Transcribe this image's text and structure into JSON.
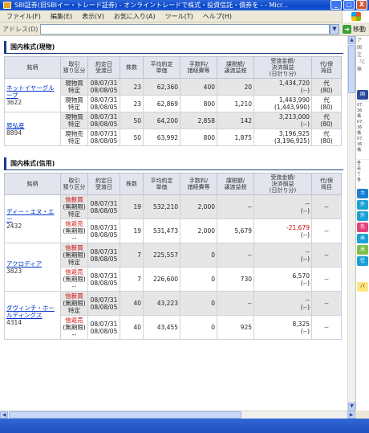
{
  "window": {
    "title": "SBI証券(旧SBIイー・トレード証券) - オンライントレードで株式・投資信託・債券を - - Micr...",
    "buttons": {
      "minimize": "_",
      "maximize": "□",
      "close": "X"
    }
  },
  "menu": [
    "ファイル(F)",
    "編集(E)",
    "表示(V)",
    "お気に入り(A)",
    "ツール(T)",
    "ヘルプ(H)"
  ],
  "address": {
    "label": "アドレス(D)",
    "value": "",
    "go_label": "移動"
  },
  "cash_section": {
    "title": "国内株式(現物)",
    "headers": {
      "name": "銘柄",
      "category": "取引\n預り区分",
      "date": "約定日\n受渡日",
      "qty": "株数",
      "price": "平均約定\n単価",
      "fee": "手数料/\n諸経費等",
      "tax": "課税額/\n譲渡益税",
      "amount": "受渡金額/\n決済損益\n(日計り分)",
      "extra": "代/保\n拇目"
    },
    "rows": [
      {
        "name": "ネットイヤーグループ",
        "code": "3622",
        "type": "現物買",
        "account": "特定",
        "trade_date": "08/07/31",
        "settle_date": "08/08/05",
        "qty": "23",
        "price": "62,360",
        "fee": "400",
        "tax": "20",
        "amount": "1,434,720",
        "pl": "(--)",
        "extra1": "代",
        "extra2": "(80)"
      },
      {
        "name": "",
        "code": "",
        "type": "現物買",
        "account": "特定",
        "trade_date": "08/07/31",
        "settle_date": "08/08/05",
        "qty": "23",
        "price": "62,869",
        "fee": "800",
        "tax": "1,210",
        "amount": "1,443,990",
        "pl": "(1,443,990)",
        "extra1": "代",
        "extra2": "(80)"
      },
      {
        "name": "原弘産",
        "code": "8894",
        "type": "現物買",
        "account": "特定",
        "trade_date": "08/07/31",
        "settle_date": "08/08/05",
        "qty": "50",
        "price": "64,200",
        "fee": "2,858",
        "tax": "142",
        "amount": "3,213,000",
        "pl": "(--)",
        "extra1": "代",
        "extra2": "(80)"
      },
      {
        "name": "",
        "code": "",
        "type": "現物売",
        "account": "特定",
        "trade_date": "08/07/31",
        "settle_date": "08/08/05",
        "qty": "50",
        "price": "63,992",
        "fee": "800",
        "tax": "1,875",
        "amount": "3,196,925",
        "pl": "(3,196,925)",
        "extra1": "代",
        "extra2": "(80)"
      }
    ]
  },
  "margin_section": {
    "title": "国内株式(信用)",
    "headers": {
      "name": "銘柄",
      "category": "取引\n預り区分",
      "date": "約定日\n受渡日",
      "qty": "株数",
      "price": "平均約定\n単価",
      "fee": "手数料/\n諸経費等",
      "tax": "課税額/\n譲渡益税",
      "amount": "受渡金額/\n決済損益\n(日計り分)",
      "extra": "代/保\n拇目"
    },
    "rows": [
      {
        "name": "ディー・エヌ・エー",
        "code": "2432",
        "type": "信新買",
        "term": "(無期限)",
        "account": "特定",
        "trade_date": "08/07/31",
        "settle_date": "08/08/05",
        "qty": "19",
        "price": "532,210",
        "fee": "2,000",
        "tax": "--",
        "amount": "--",
        "pl": "(--)",
        "extra": "--"
      },
      {
        "name": "",
        "code": "",
        "type": "信返売",
        "term": "(無期限)",
        "account": "--",
        "trade_date": "08/07/31",
        "settle_date": "08/08/05",
        "qty": "19",
        "price": "531,473",
        "fee": "2,000",
        "tax": "5,679",
        "amount": "-21,679",
        "pl": "(--)",
        "extra": "--"
      },
      {
        "name": "アクロディア",
        "code": "3823",
        "type": "信新買",
        "term": "(無期限)",
        "account": "特定",
        "trade_date": "08/07/31",
        "settle_date": "08/08/05",
        "qty": "7",
        "price": "225,557",
        "fee": "0",
        "tax": "--",
        "amount": "--",
        "pl": "(--)",
        "extra": "--"
      },
      {
        "name": "",
        "code": "",
        "type": "信返売",
        "term": "(無期限)",
        "account": "--",
        "trade_date": "08/07/31",
        "settle_date": "08/08/05",
        "qty": "7",
        "price": "226,600",
        "fee": "0",
        "tax": "730",
        "amount": "6,570",
        "pl": "(--)",
        "extra": "--"
      },
      {
        "name": "ダヴィンチ・ホールディングス",
        "code": "4314",
        "type": "信新買",
        "term": "(無期限)",
        "account": "特定",
        "trade_date": "08/07/31",
        "settle_date": "08/08/05",
        "qty": "40",
        "price": "43,223",
        "fee": "0",
        "tax": "--",
        "amount": "--",
        "pl": "(--)",
        "extra": "--"
      },
      {
        "name": "",
        "code": "",
        "type": "信返売",
        "term": "(無期限)",
        "account": "--",
        "trade_date": "08/07/31",
        "settle_date": "08/08/05",
        "qty": "40",
        "price": "43,455",
        "fee": "0",
        "tax": "925",
        "amount": "8,325",
        "pl": "(--)",
        "extra": "--"
      }
    ]
  },
  "right_pane": {
    "top_text": [
      "ア",
      "国",
      "注",
      "「C",
      "無"
    ],
    "side_label": "国",
    "news": [
      "07.",
      "36",
      "構",
      "07.",
      "36",
      "構",
      "07.",
      "36",
      "構"
    ],
    "extra_text": [
      "各",
      "是",
      "て",
      "各"
    ],
    "buttons": [
      {
        "label": "カ",
        "color": "#1b7fd1"
      },
      {
        "label": "外",
        "color": "#1ca0d6"
      },
      {
        "label": "外",
        "color": "#1ca0d6"
      },
      {
        "label": "先",
        "color": "#e0457b"
      },
      {
        "label": "米",
        "color": "#1ca0d6"
      },
      {
        "label": "米",
        "color": "#7cc04a"
      },
      {
        "label": "往",
        "color": "#1ca0d6"
      }
    ],
    "bottom_label": "バ"
  },
  "colors": {
    "title_bar": "#0a48c8",
    "header_bg": "#e2e5ee",
    "section_accent": "#1b3a8a",
    "link": "#0033cc",
    "negative": "#c00000"
  }
}
